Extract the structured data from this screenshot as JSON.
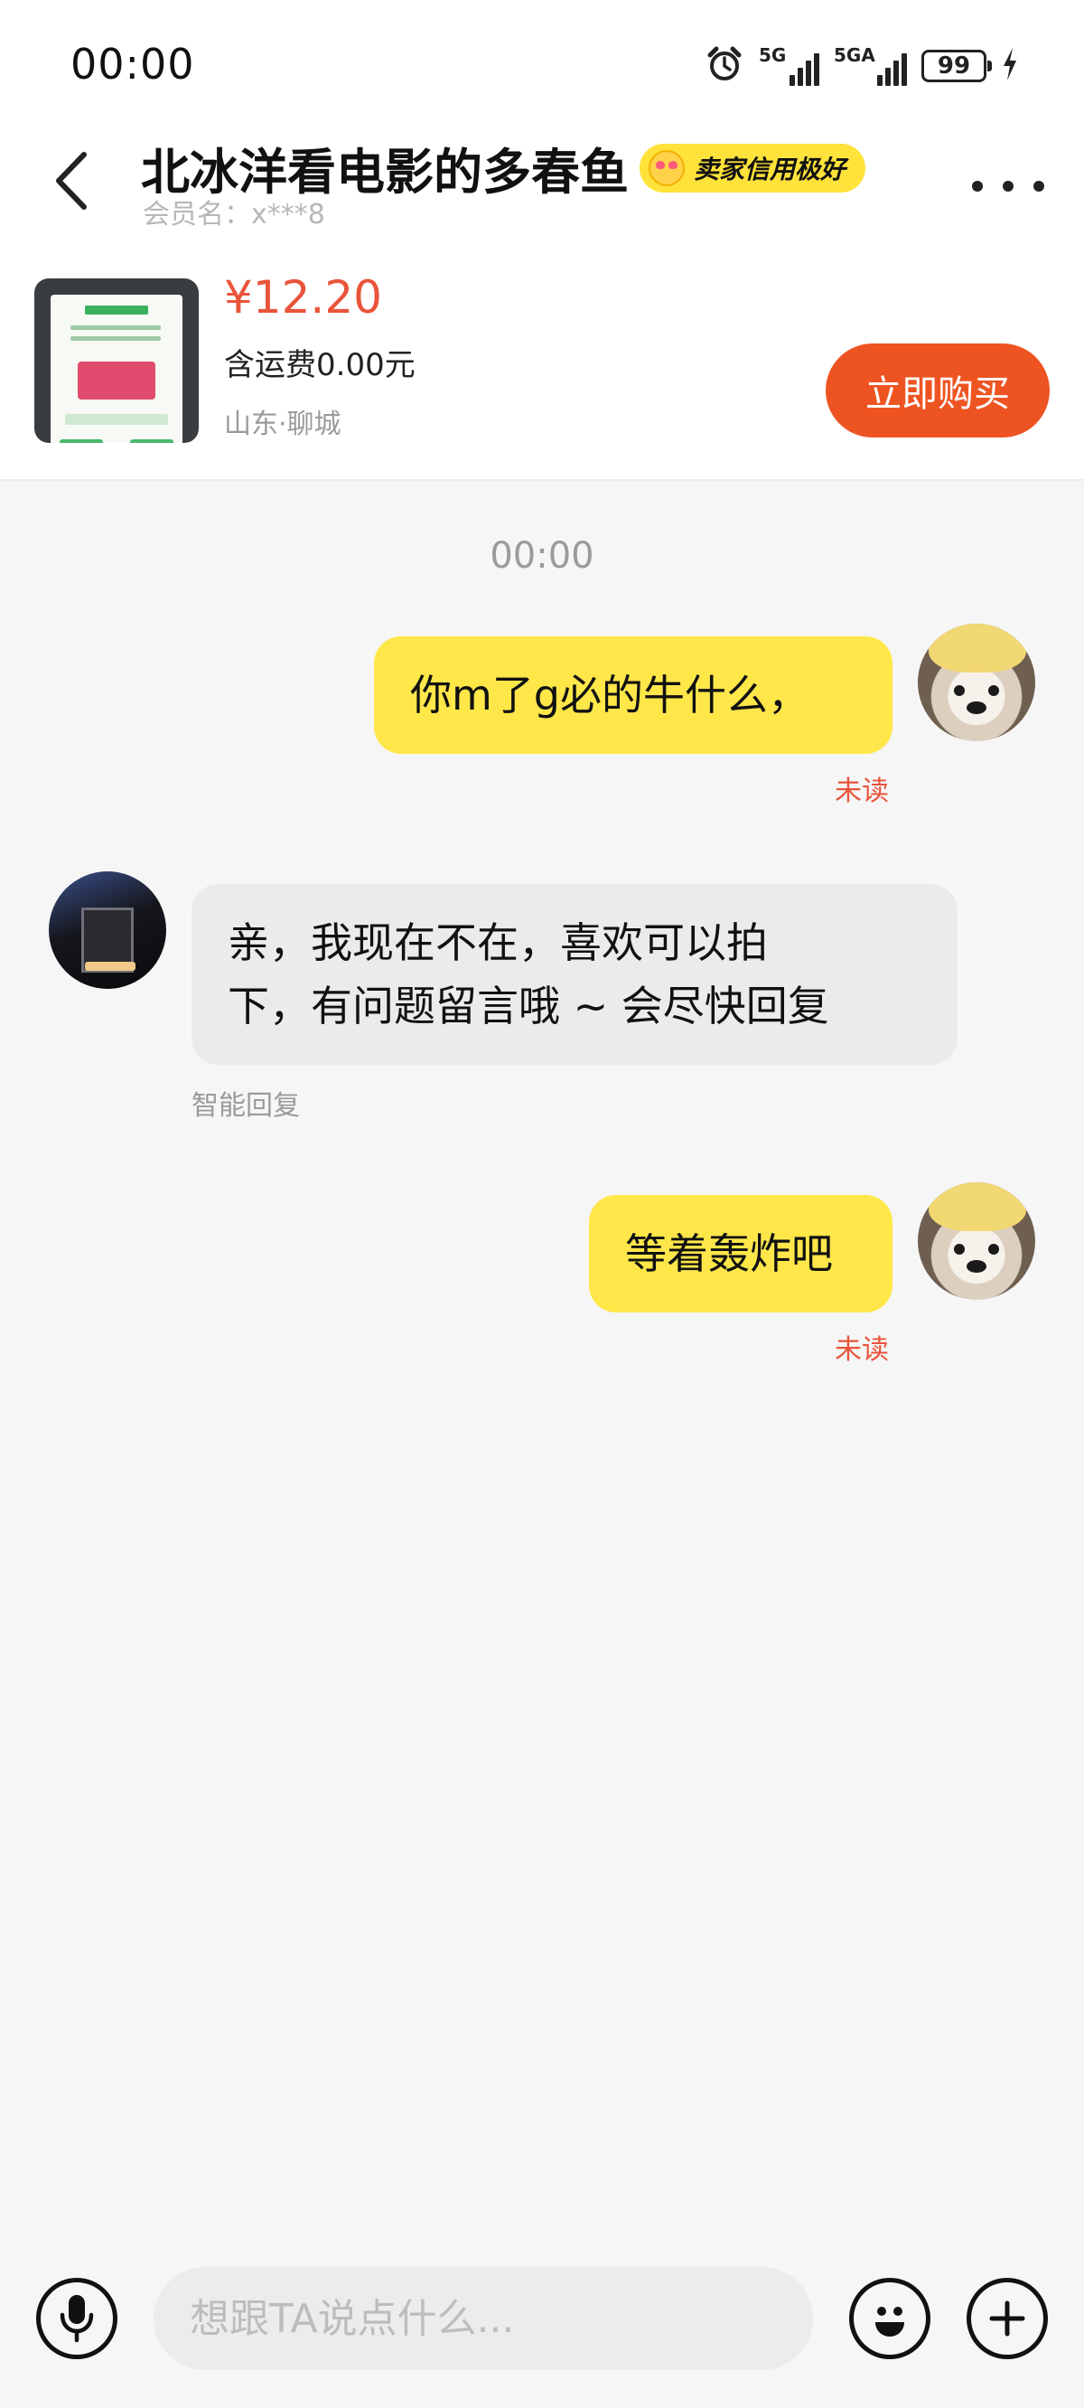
{
  "status_bar": {
    "time": "00:00",
    "network1": "5G",
    "network2": "5GA",
    "battery": "99"
  },
  "header": {
    "seller_name": "北冰洋看电影的多春鱼",
    "credit_badge": "卖家信用极好",
    "member_label": "会员名：x***8"
  },
  "product": {
    "price": "¥12.20",
    "shipping": "含运费0.00元",
    "location": "山东·聊城",
    "buy_label": "立即购买"
  },
  "chat": {
    "timestamp": "00:00",
    "messages": [
      {
        "from": "me",
        "text": "你m了g必的牛什么，",
        "status": "未读"
      },
      {
        "from": "them",
        "line1": "亲，我现在不在，喜欢可以拍",
        "line2": "下，有问题留言哦 ~ 会尽快回复",
        "tag": "智能回复"
      },
      {
        "from": "me",
        "text": "等着轰炸吧",
        "status": "未读"
      }
    ]
  },
  "input": {
    "placeholder": "想跟TA说点什么..."
  },
  "colors": {
    "accent_orange": "#ee5422",
    "price_red": "#e9543a",
    "my_bubble": "#ffe74a",
    "their_bubble": "#ebebec",
    "badge_yellow": "#ffe23a"
  },
  "icons": {
    "back": "chevron-left-icon",
    "more": "more-dots-icon",
    "voice": "microphone-icon",
    "emoji": "smile-icon",
    "plus": "plus-icon",
    "alarm": "alarm-clock-icon",
    "charging": "lightning-icon"
  }
}
